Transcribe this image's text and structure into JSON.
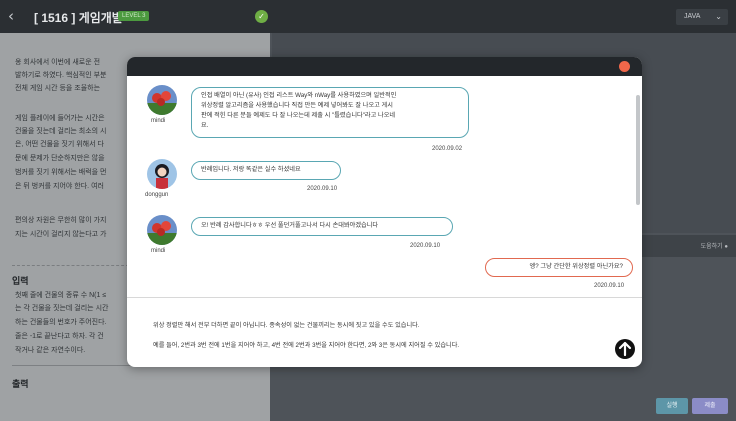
{
  "header": {
    "back_icon": "‹",
    "title": "[ 1516 ] 게임개발",
    "level": "LEVEL 3",
    "language": "JAVA"
  },
  "problem": {
    "lines1": [
      "옹 회사에서 이번에 새로운 전",
      "발하기로 하였다. 핵심적인 부분",
      "전체 게임 시간 등을 조율하는"
    ],
    "lines2": [
      "게임 플레이에 들어가는 시간은",
      "건물을 짓는데 걸리는 최소의 시",
      "은, 어떤 건물을 짓기 위해서 다",
      "문에 문제가 단순하지만은 않을",
      "범커를 짓기 위해서는 배럭을 먼",
      "은 뒤 벙커를 지어야 한다. 여러"
    ],
    "lines3": [
      "편의상 자원은 무한히 많이 가지",
      "지는 시간이 걸리지 않는다고 가"
    ],
    "input_title": "입력",
    "input_lines": [
      "첫째 줄에 건물의 종류 수 N(1 ≤",
      "는 각 건물을 짓는데 걸리는 시간",
      "하는 건물들의 번호가 주어진다.",
      "줄은 -1로 끝난다고 하자. 각 건",
      "작거나 같은 자연수이다."
    ],
    "output_title": "출력"
  },
  "editor": {
    "question_button": "도움하기"
  },
  "actions": {
    "run": "실행",
    "submit": "제출"
  },
  "chat": {
    "messages": [
      {
        "user": "mindi",
        "lines": [
          "인접 배열이 아닌 (유사) 인접 리스트 Way와 nWay를 사용하였으며 일반적인",
          "위상정렬 알고리즘을 사용했습니다 직접 만든 예제 넣어봐도 잘 나오고 게시",
          "판에 적힌 다른 분들 예제도 다 잘 나오는데 제출 시 \"틀렸습니다\"라고 나오네",
          "요."
        ],
        "date": "2020.09.02"
      },
      {
        "user": "donggun",
        "lines": [
          "반례입니다. 저랑 똑같은 실수 하셨네요"
        ],
        "date": "2020.09.10"
      },
      {
        "user": "mindi",
        "lines": [
          "오! 반례 감사합니다ㅎㅎ 우선 풀던거풀고나서 다시 손대봐야겠습니다"
        ],
        "date": "2020.09.10"
      },
      {
        "user": "",
        "lines": [
          "엥? 그냥 간단한 위상정렬 아닌가요?"
        ],
        "date": "2020.09.10"
      }
    ],
    "footer_lines": [
      "위상 정렬만 해서 전부 더하면 끝이 아닙니다. 종속성이 없는 건물끼리는 동시에 짓고 있을 수도 있습니다.",
      "예를 들어, 2번과 3번 전에 1번을 지어야 하고, 4번 전에 2번과 3번을 지어야 한다면, 2와 3은 동시에 지어질 수 있습니다."
    ]
  },
  "colors": {
    "accent_teal": "#5aa7b3",
    "accent_coral": "#e16950",
    "close": "#f0674a",
    "run": "#5d96a8",
    "submit": "#8b8cc7"
  }
}
